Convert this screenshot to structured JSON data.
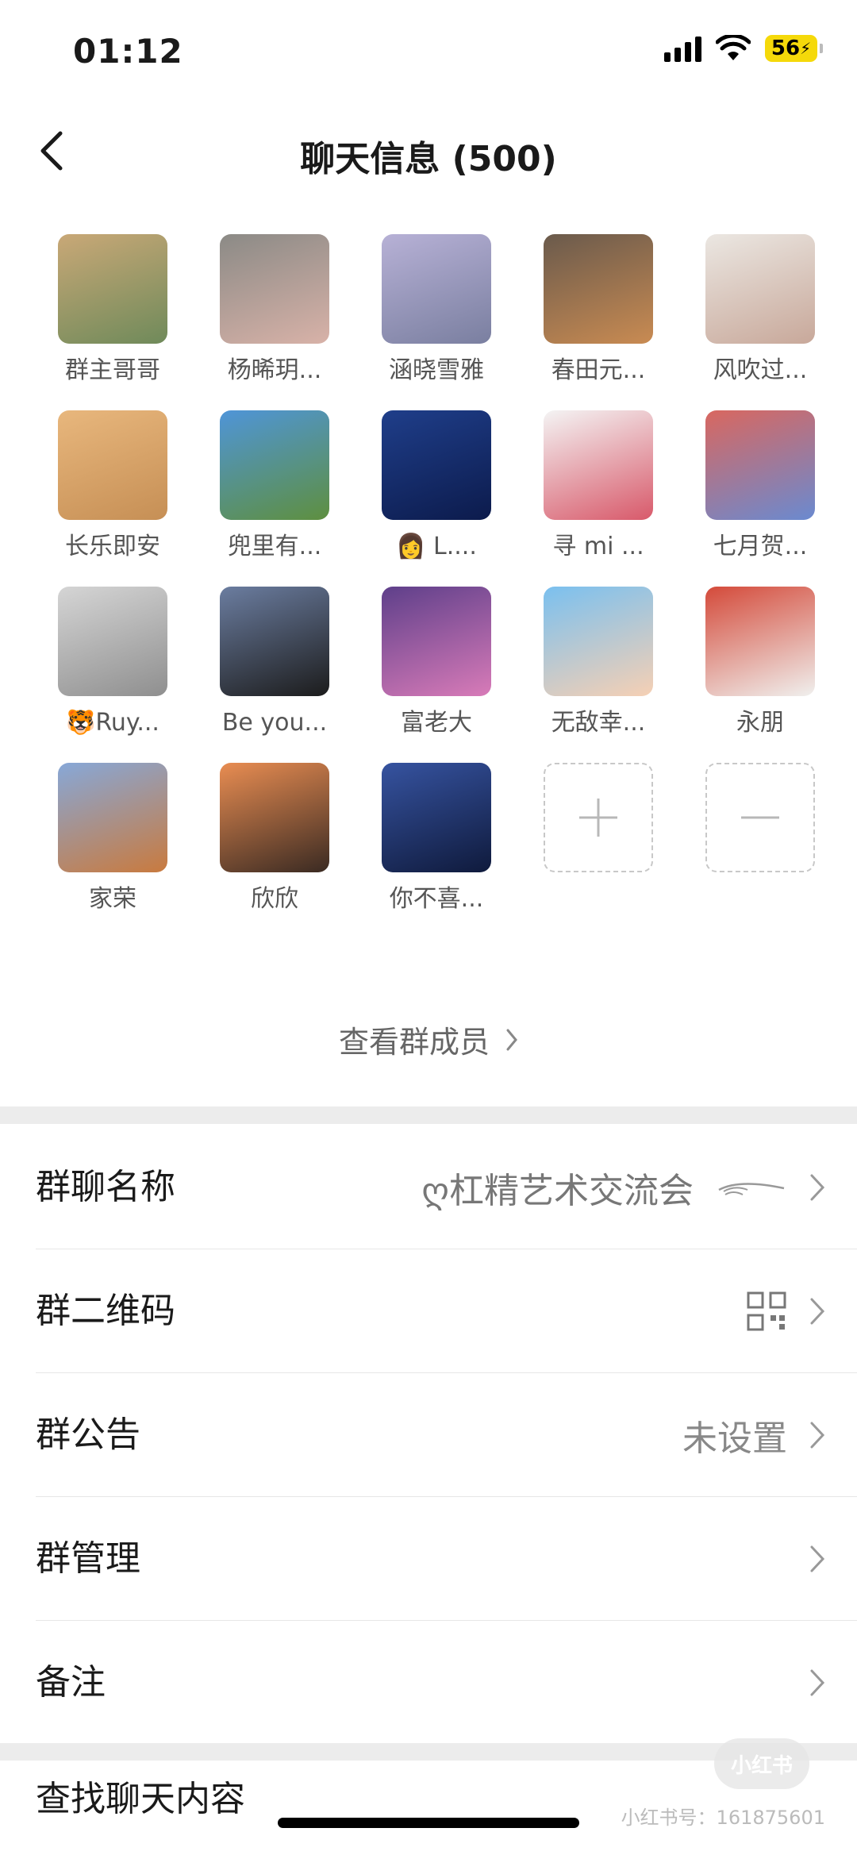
{
  "status": {
    "time": "01:12",
    "battery": "56"
  },
  "nav": {
    "title": "聊天信息 (500)"
  },
  "members": [
    {
      "name": "群主哥哥",
      "colors": [
        "#c9a877",
        "#6f8a5a"
      ]
    },
    {
      "name": "杨晞玥...",
      "colors": [
        "#8b8a86",
        "#d8b2a8"
      ]
    },
    {
      "name": "涵晓雪雅",
      "colors": [
        "#b7b1d6",
        "#7a7fa0"
      ]
    },
    {
      "name": "春田元...",
      "colors": [
        "#6a5a4c",
        "#c98b52"
      ]
    },
    {
      "name": "风吹过...",
      "colors": [
        "#ebe7e2",
        "#c8a89a"
      ]
    },
    {
      "name": "长乐即安",
      "colors": [
        "#e8b77d",
        "#c68f55"
      ]
    },
    {
      "name": "兜里有...",
      "colors": [
        "#4f95d8",
        "#5e8f3f"
      ]
    },
    {
      "name": "👩 L....",
      "colors": [
        "#1f3e8a",
        "#0c1b4c"
      ]
    },
    {
      "name": "寻 mi ...",
      "colors": [
        "#f4f4f4",
        "#d8596a"
      ]
    },
    {
      "name": "七月贺...",
      "colors": [
        "#d9675f",
        "#6a8ad0"
      ]
    },
    {
      "name": "🐯Ruy...",
      "colors": [
        "#d5d5d5",
        "#8f8f8f"
      ]
    },
    {
      "name": "Be you...",
      "colors": [
        "#6b7da0",
        "#1c1c1c"
      ]
    },
    {
      "name": "富老大",
      "colors": [
        "#5e3f8a",
        "#d87bb8"
      ]
    },
    {
      "name": "无敌幸...",
      "colors": [
        "#7ac0ef",
        "#f6d0b4"
      ]
    },
    {
      "name": "永朋",
      "colors": [
        "#d44a3a",
        "#f0f0ee"
      ]
    },
    {
      "name": "家荣",
      "colors": [
        "#87a8d8",
        "#c97a3e"
      ]
    },
    {
      "name": "欣欣",
      "colors": [
        "#e98d52",
        "#3a2a22"
      ]
    },
    {
      "name": "你不喜...",
      "colors": [
        "#3653a0",
        "#0f1a3c"
      ]
    }
  ],
  "add_button_label": "+",
  "remove_button_label": "—",
  "view_members": "查看群成员",
  "settings": {
    "group_name": {
      "label": "群聊名称",
      "value": "ღ杠精艺术交流会"
    },
    "qr_code": {
      "label": "群二维码"
    },
    "announcement": {
      "label": "群公告",
      "value": "未设置"
    },
    "manage": {
      "label": "群管理"
    },
    "remark": {
      "label": "备注"
    },
    "search_history": {
      "label": "查找聊天内容"
    }
  },
  "watermark": {
    "logo": "小红书",
    "text": "小红书号：161875601"
  },
  "colors": {
    "divider": "#ececec",
    "muted_text": "#888888"
  }
}
